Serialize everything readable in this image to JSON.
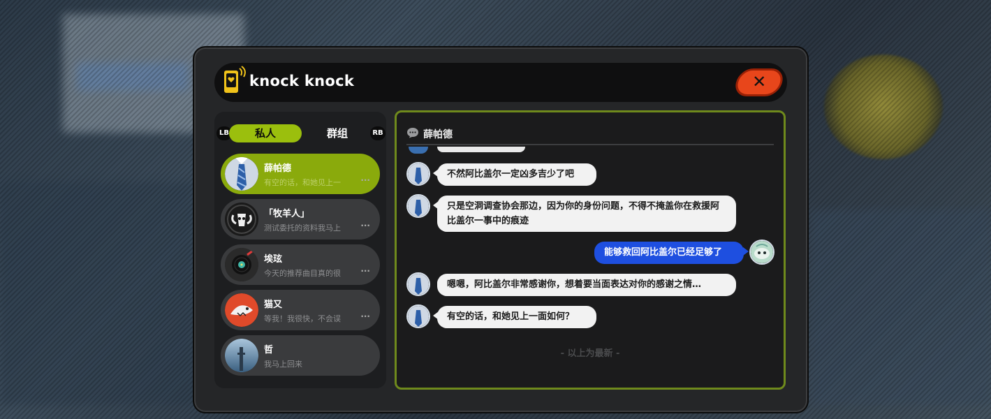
{
  "header": {
    "title": "knock knock",
    "close_label": "✕",
    "icon": "phone-heart-icon"
  },
  "tabs": {
    "lb": "LB",
    "rb": "RB",
    "private": "私人",
    "group": "群组"
  },
  "contacts": [
    {
      "name": "薛帕德",
      "preview": "有空的话，和她见上一",
      "more": "···",
      "active": true,
      "avatar": "tie-avatar"
    },
    {
      "name": "「牧羊人」",
      "preview": "测试委托的资料我马上",
      "more": "···",
      "active": false,
      "avatar": "ram-skull-avatar"
    },
    {
      "name": "埃玹",
      "preview": "今天的推荐曲目真的很",
      "more": "···",
      "active": false,
      "avatar": "vinyl-avatar"
    },
    {
      "name": "猫又",
      "preview": "等我！我很快，不会误",
      "more": "···",
      "active": false,
      "avatar": "shark-avatar"
    },
    {
      "name": "哲",
      "preview": "我马上回来",
      "more": "",
      "active": false,
      "avatar": "tower-avatar"
    }
  ],
  "chat": {
    "title": "薛帕德",
    "messages": [
      {
        "from": "in",
        "text": "不然阿比盖尔一定凶多吉少了吧"
      },
      {
        "from": "in",
        "text": "只是空洞调查协会那边，因为你的身份问题，不得不掩盖你在救援阿比盖尔一事中的痕迹"
      },
      {
        "from": "out",
        "text": "能够救回阿比盖尔已经足够了"
      },
      {
        "from": "in",
        "text": "嗯嗯，阿比盖尔非常感谢你，想着要当面表达对你的感谢之情…"
      },
      {
        "from": "in",
        "text": "有空的话，和她见上一面如何？"
      }
    ],
    "end_note": "- 以上为最新 -"
  },
  "colors": {
    "accent_green": "#9bbf0d",
    "close_red": "#e8461b",
    "bubble_blue": "#1e4fe0"
  }
}
